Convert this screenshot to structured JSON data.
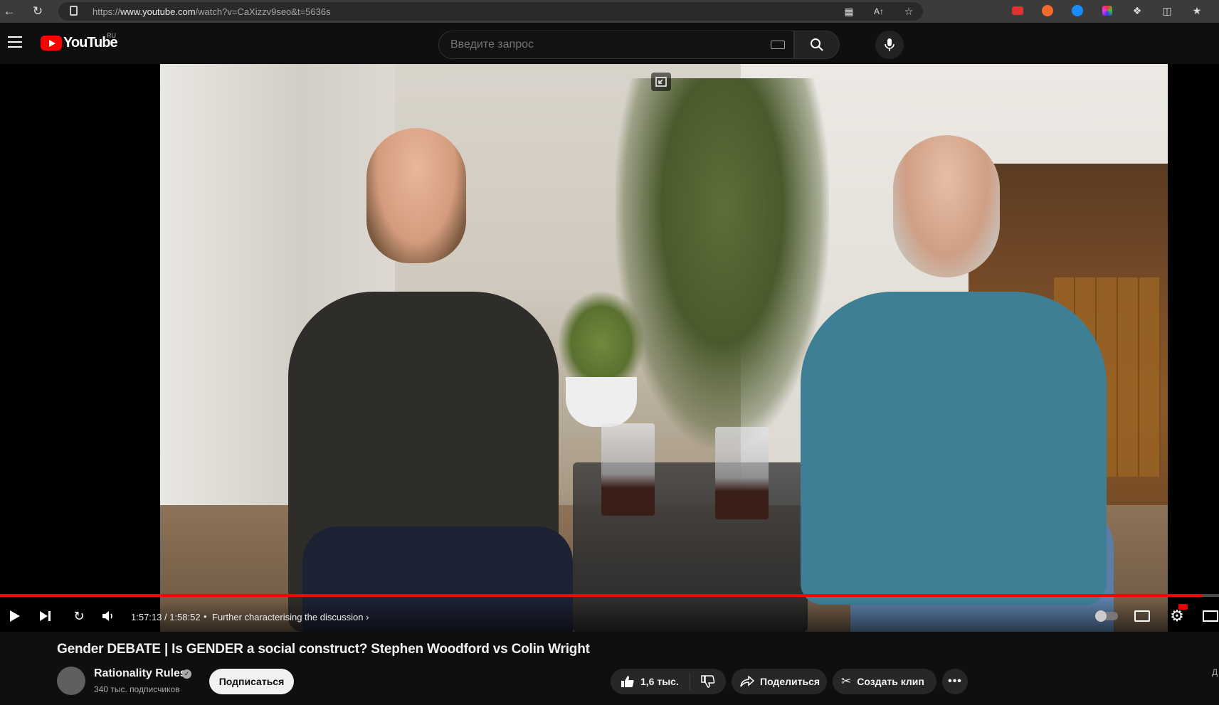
{
  "browser": {
    "url_prefix": "https://",
    "url_domain": "www.youtube.com",
    "url_path": "/watch?v=CaXizzv9seo&t=5636s"
  },
  "header": {
    "logo_text": "YouTube",
    "region": "RU",
    "search_placeholder": "Введите запрос"
  },
  "player": {
    "current_time": "1:57:13",
    "duration": "1:58:52",
    "time_display": "1:57:13 / 1:58:52",
    "chapter_title": "Further characterising the discussion",
    "progress_fraction": 0.986
  },
  "video": {
    "title": "Gender DEBATE | Is GENDER a social construct? Stephen Woodford vs Colin Wright"
  },
  "channel": {
    "name": "Rationality Rules",
    "subscribers": "340 тыс. подписчиков",
    "subscribe_label": "Подписаться"
  },
  "actions": {
    "likes": "1,6 тыс.",
    "share_label": "Поделиться",
    "clip_label": "Создать клип"
  },
  "side": {
    "partial_text": "Д"
  },
  "colors": {
    "brand_red": "#ff0000",
    "background": "#0f0f0f"
  }
}
